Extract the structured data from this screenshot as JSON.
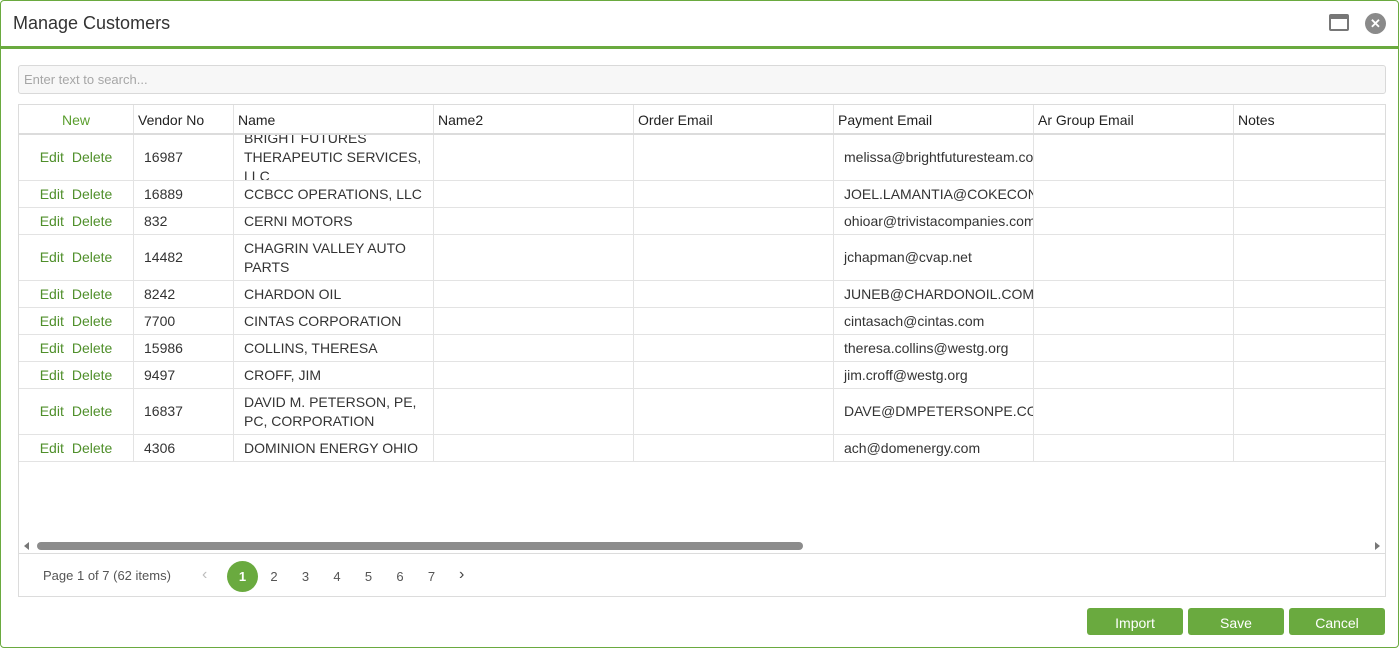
{
  "window": {
    "title": "Manage Customers",
    "maximize_icon": "window-maximize-icon",
    "close_icon": "close-icon",
    "close_glyph": "✕"
  },
  "search": {
    "placeholder": "Enter text to search...",
    "value": ""
  },
  "grid": {
    "columns": [
      "New",
      "Vendor No",
      "Name",
      "Name2",
      "Order Email",
      "Payment Email",
      "Ar Group Email",
      "Notes"
    ],
    "row_actions": {
      "edit": "Edit",
      "delete": "Delete"
    },
    "rows": [
      {
        "vendor_no": "16987",
        "name": "BRIGHT FUTURES THERAPEUTIC SERVICES, LLC",
        "name2": "",
        "order_email": "",
        "payment_email": "melissa@brightfuturesteam.com",
        "ar_group_email": "",
        "notes": ""
      },
      {
        "vendor_no": "16889",
        "name": "CCBCC OPERATIONS, LLC",
        "name2": "",
        "order_email": "",
        "payment_email": "JOEL.LAMANTIA@COKECONSOLIDATED.COM",
        "ar_group_email": "",
        "notes": ""
      },
      {
        "vendor_no": "832",
        "name": "CERNI MOTORS",
        "name2": "",
        "order_email": "",
        "payment_email": "ohioar@trivistacompanies.com",
        "ar_group_email": "",
        "notes": ""
      },
      {
        "vendor_no": "14482",
        "name": "CHAGRIN VALLEY AUTO PARTS",
        "name2": "",
        "order_email": "",
        "payment_email": "jchapman@cvap.net",
        "ar_group_email": "",
        "notes": ""
      },
      {
        "vendor_no": "8242",
        "name": "CHARDON OIL",
        "name2": "",
        "order_email": "",
        "payment_email": "JUNEB@CHARDONOIL.COM",
        "ar_group_email": "",
        "notes": ""
      },
      {
        "vendor_no": "7700",
        "name": "CINTAS CORPORATION",
        "name2": "",
        "order_email": "",
        "payment_email": "cintasach@cintas.com",
        "ar_group_email": "",
        "notes": ""
      },
      {
        "vendor_no": "15986",
        "name": "COLLINS, THERESA",
        "name2": "",
        "order_email": "",
        "payment_email": "theresa.collins@westg.org",
        "ar_group_email": "",
        "notes": ""
      },
      {
        "vendor_no": "9497",
        "name": "CROFF, JIM",
        "name2": "",
        "order_email": "",
        "payment_email": "jim.croff@westg.org",
        "ar_group_email": "",
        "notes": ""
      },
      {
        "vendor_no": "16837",
        "name": "DAVID M. PETERSON, PE, PC, CORPORATION",
        "name2": "",
        "order_email": "",
        "payment_email": "DAVE@DMPETERSONPE.COM",
        "ar_group_email": "",
        "notes": ""
      },
      {
        "vendor_no": "4306",
        "name": "DOMINION ENERGY OHIO",
        "name2": "",
        "order_email": "",
        "payment_email": "ach@domenergy.com",
        "ar_group_email": "",
        "notes": ""
      }
    ]
  },
  "pager": {
    "info": "Page 1 of 7 (62 items)",
    "pages": [
      "1",
      "2",
      "3",
      "4",
      "5",
      "6",
      "7"
    ],
    "current": "1",
    "prev_glyph": "‹",
    "next_glyph": "›"
  },
  "footer": {
    "import_label": "Import",
    "save_label": "Save",
    "cancel_label": "Cancel"
  },
  "colors": {
    "accent": "#6aaa3f",
    "link": "#4f8f2a"
  }
}
